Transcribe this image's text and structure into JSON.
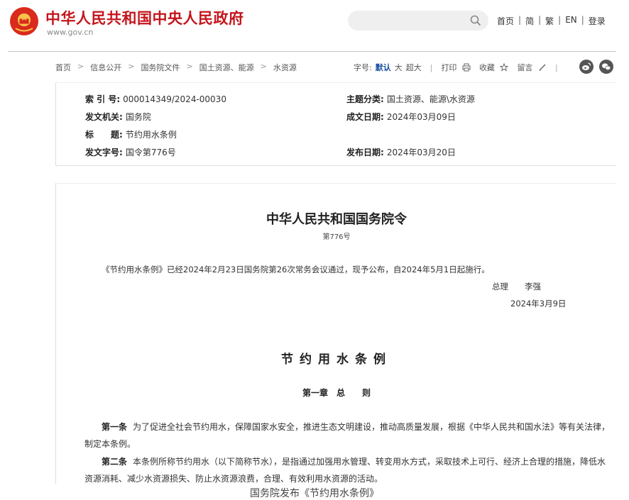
{
  "header": {
    "site_title": "中华人民共和国中央人民政府",
    "site_url": "www.gov.cn",
    "search_placeholder": "",
    "nav": [
      "首页",
      "简",
      "繁",
      "EN",
      "登录"
    ],
    "nav_separator": "|"
  },
  "breadcrumb": [
    "首页",
    "信息公开",
    "国务院文件",
    "国土资源、能源",
    "水资源"
  ],
  "breadcrumb_separator": ">",
  "tools": {
    "font_size_label": "字号:",
    "font_default": "默认",
    "font_large": "大",
    "font_xlarge": "超大",
    "divider": "|",
    "print": "打印",
    "favorite": "收藏",
    "comment": "留言"
  },
  "meta": {
    "index_key": "索 引 号:",
    "index_val": "000014349/2024-00030",
    "category_key": "主题分类:",
    "category_val": "国土资源、能源\\水资源",
    "issuer_key": "发文机关:",
    "issuer_val": "国务院",
    "written_key": "成文日期:",
    "written_val": "2024年03月09日",
    "title_key": "标　　题:",
    "title_val": "节约用水条例",
    "docno_key": "发文字号:",
    "docno_val": "国令第776号",
    "publish_key": "发布日期:",
    "publish_val": "2024年03月20日"
  },
  "doc": {
    "title": "中华人民共和国国务院令",
    "number": "第776号",
    "intro": "《节约用水条例》已经2024年2月23日国务院第26次常务会议通过，现予公布，自2024年5月1日起施行。",
    "signer_title": "总理",
    "signer_name": "李强",
    "sign_date": "2024年3月9日",
    "law_title": "节约用水条例",
    "chapter": "第一章　总　　则",
    "articles": [
      {
        "label": "第一条",
        "text": "为了促进全社会节约用水，保障国家水安全，推进生态文明建设，推动高质量发展，根据《中华人民共和国水法》等有关法律，制定本条例。"
      },
      {
        "label": "第二条",
        "text": "本条例所称节约用水（以下简称节水），是指通过加强用水管理、转变用水方式，采取技术上可行、经济上合理的措施，降低水资源消耗、减少水资源损失、防止水资源浪费，合理、有效利用水资源的活动。"
      }
    ]
  },
  "caption": "国务院发布《节约用水条例》",
  "colors": {
    "brand_red": "#c4151c",
    "link_blue": "#1a4fa0",
    "emblem_gold": "#f6c24a"
  }
}
